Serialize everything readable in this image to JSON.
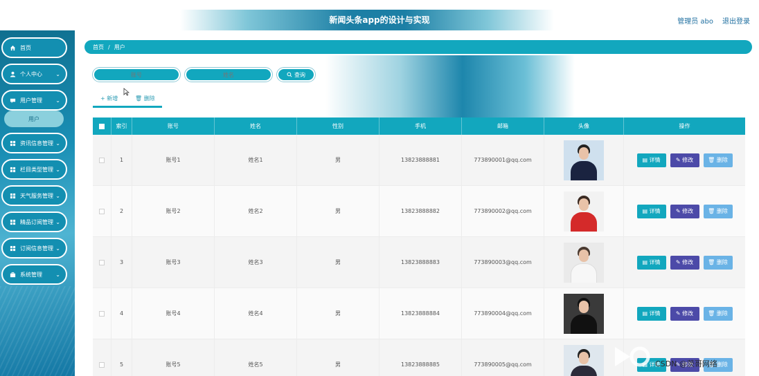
{
  "header": {
    "title": "新闻头条app的设计与实现",
    "user": "管理员 abo",
    "logout": "退出登录"
  },
  "sidebar": {
    "items": [
      {
        "label": "首页",
        "icon": "home-icon"
      },
      {
        "label": "个人中心",
        "icon": "user-icon"
      },
      {
        "label": "用户管理",
        "icon": "chat-icon"
      },
      {
        "label": "资讯信息管理",
        "icon": "grid-icon"
      },
      {
        "label": "栏目类型管理",
        "icon": "grid-icon"
      },
      {
        "label": "天气服务管理",
        "icon": "grid-icon"
      },
      {
        "label": "精品订阅管理",
        "icon": "grid-icon"
      },
      {
        "label": "订阅信息管理",
        "icon": "grid-icon"
      },
      {
        "label": "系统管理",
        "icon": "briefcase-icon"
      }
    ],
    "submenu": "用户"
  },
  "breadcrumb": {
    "home": "首页",
    "separator": "/",
    "current": "用户"
  },
  "search": {
    "account_placeholder": "账号",
    "name_placeholder": "姓名",
    "button": "查询"
  },
  "actions": {
    "add": "+ 新增",
    "delete": "删除"
  },
  "table": {
    "headers": [
      "索引",
      "账号",
      "姓名",
      "性别",
      "手机",
      "邮箱",
      "头像",
      "操作"
    ],
    "rows": [
      {
        "index": "1",
        "account": "账号1",
        "name": "姓名1",
        "gender": "男",
        "phone": "13823888881",
        "email": "773890001@qq.com"
      },
      {
        "index": "2",
        "account": "账号2",
        "name": "姓名2",
        "gender": "男",
        "phone": "13823888882",
        "email": "773890002@qq.com"
      },
      {
        "index": "3",
        "account": "账号3",
        "name": "姓名3",
        "gender": "男",
        "phone": "13823888883",
        "email": "773890003@qq.com"
      },
      {
        "index": "4",
        "account": "账号4",
        "name": "姓名4",
        "gender": "男",
        "phone": "13823888884",
        "email": "773890004@qq.com"
      },
      {
        "index": "5",
        "account": "账号5",
        "name": "姓名5",
        "gender": "男",
        "phone": "13823888885",
        "email": "773890005@qq.com"
      }
    ],
    "ops": {
      "detail": "详情",
      "edit": "修改",
      "delete": "删除"
    }
  },
  "watermark": {
    "text": "CSDN @茨哥网络"
  },
  "colors": {
    "accent": "#12a7be",
    "edit": "#4c4aa8",
    "delete": "#6ab3e6",
    "sidebar": "#138fb1"
  }
}
